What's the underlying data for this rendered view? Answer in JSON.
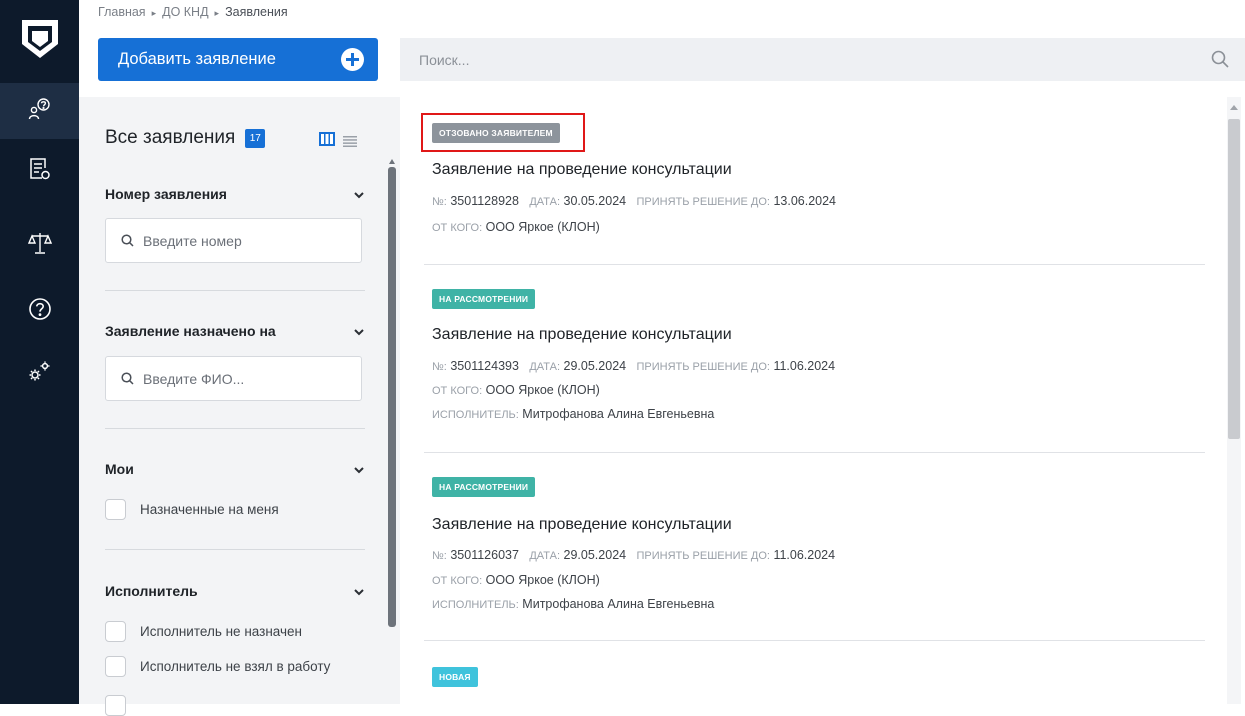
{
  "breadcrumb": {
    "home": "Главная",
    "section": "ДО КНД",
    "current": "Заявления",
    "separator": "▸"
  },
  "toolbar": {
    "add_label": "Добавить заявление",
    "add_icon": "plus-circle-icon"
  },
  "search": {
    "placeholder": "Поиск...",
    "value": ""
  },
  "rail": {
    "bg_color": "#0d1a2b",
    "items": [
      {
        "icon": "logo-shield-icon"
      },
      {
        "icon": "user-question-icon",
        "active": true
      },
      {
        "icon": "document-list-icon"
      },
      {
        "icon": "scales-icon"
      },
      {
        "icon": "help-circle-icon"
      },
      {
        "icon": "settings-gears-icon"
      }
    ]
  },
  "filters": {
    "title": "Все заявления",
    "count": "17",
    "view_icons": [
      "columns-view-icon",
      "list-view-icon"
    ],
    "sections": {
      "number": {
        "label": "Номер заявления",
        "placeholder": "Введите номер"
      },
      "assigned": {
        "label": "Заявление назначено на",
        "placeholder": "Введите ФИО..."
      },
      "mine": {
        "label": "Мои",
        "options": [
          "Назначенные на меня"
        ]
      },
      "executor": {
        "label": "Исполнитель",
        "options": [
          "Исполнитель не назначен",
          "Исполнитель не взял в работу"
        ]
      }
    }
  },
  "labels": {
    "number": "№:",
    "date": "ДАТА:",
    "deadline": "ПРИНЯТЬ РЕШЕНИЕ ДО:",
    "from": "ОТ КОГО:",
    "executor": "ИСПОЛНИТЕЛЬ:"
  },
  "applications": [
    {
      "status": "ОТЗОВАНО ЗАЯВИТЕЛЕМ",
      "status_color": "#8d949c",
      "title": "Заявление на проведение консультации",
      "number": "3501128928",
      "date": "30.05.2024",
      "deadline": "13.06.2024",
      "from": "ООО Яркое (КЛОН)",
      "executor": ""
    },
    {
      "status": "НА РАССМОТРЕНИИ",
      "status_color": "#3fb3a6",
      "title": "Заявление на проведение консультации",
      "number": "3501124393",
      "date": "29.05.2024",
      "deadline": "11.06.2024",
      "from": "ООО Яркое (КЛОН)",
      "executor": "Митрофанова Алина Евгеньевна"
    },
    {
      "status": "НА РАССМОТРЕНИИ",
      "status_color": "#3fb3a6",
      "title": "Заявление на проведение консультации",
      "number": "3501126037",
      "date": "29.05.2024",
      "deadline": "11.06.2024",
      "from": "ООО Яркое (КЛОН)",
      "executor": "Митрофанова Алина Евгеньевна"
    },
    {
      "status": "НОВАЯ",
      "status_color": "#3fc3dc"
    }
  ],
  "colors": {
    "accent": "#1670d6",
    "highlight": "#e01818"
  }
}
